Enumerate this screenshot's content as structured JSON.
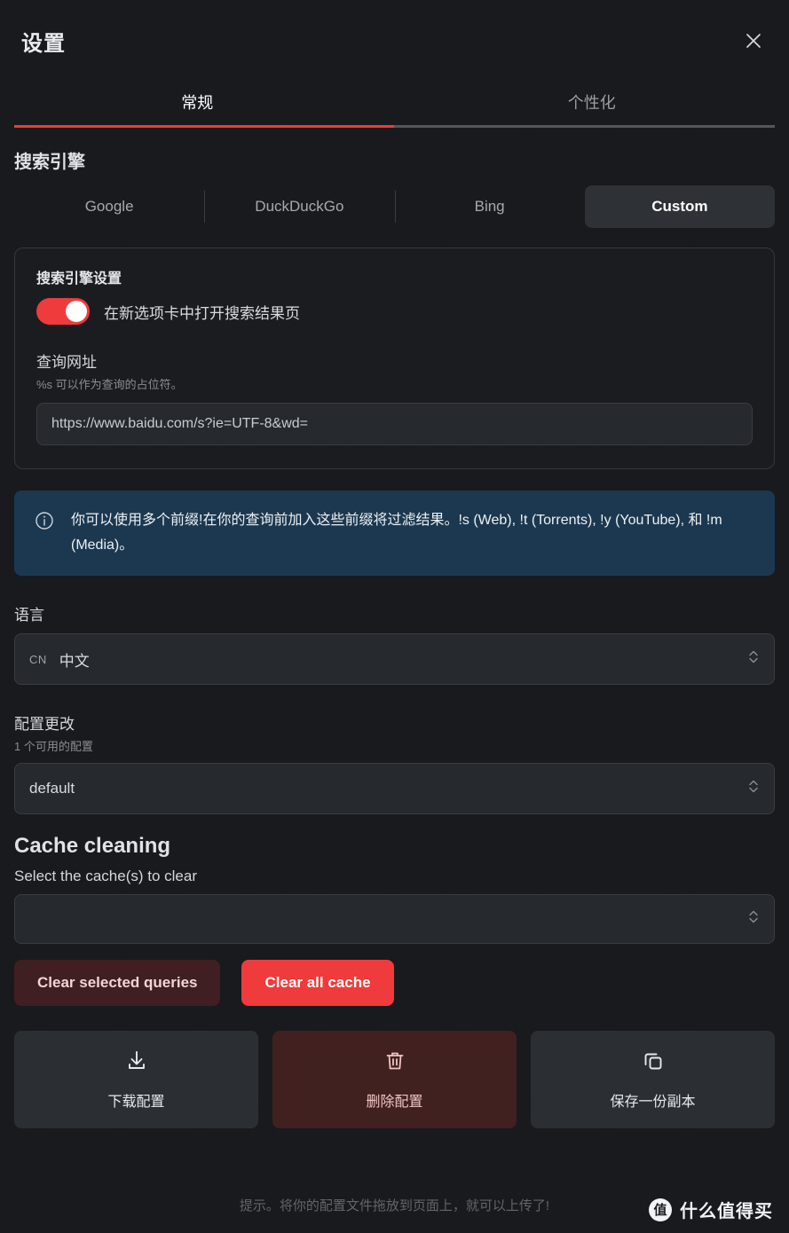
{
  "window": {
    "title": "设置",
    "close_icon": "close-icon"
  },
  "tabs": [
    {
      "label": "常规",
      "active": true
    },
    {
      "label": "个性化",
      "active": false
    }
  ],
  "search_engine": {
    "section_title": "搜索引擎",
    "options": [
      {
        "label": "Google",
        "active": false
      },
      {
        "label": "DuckDuckGo",
        "active": false
      },
      {
        "label": "Bing",
        "active": false
      },
      {
        "label": "Custom",
        "active": true
      }
    ],
    "card": {
      "title": "搜索引擎设置",
      "toggle": {
        "label": "在新选项卡中打开搜索结果页",
        "state": "on",
        "color": "#ef3b3b"
      },
      "query_url": {
        "label": "查询网址",
        "hint": "%s 可以作为查询的占位符。",
        "value": "https://www.baidu.com/s?ie=UTF-8&wd=",
        "placeholder": "https://www.baidu.com/s?ie=UTF-8&wd="
      }
    }
  },
  "info_banner": {
    "icon": "info-circle-icon",
    "text": "你可以使用多个前缀!在你的查询前加入这些前缀将过滤结果。!s (Web), !t (Torrents), !y (YouTube), 和 !m (Media)。",
    "background": "#1c3850"
  },
  "language": {
    "label": "语言",
    "flag": "CN",
    "value": "中文"
  },
  "config": {
    "label": "配置更改",
    "sub": "1 个可用的配置",
    "value": "default"
  },
  "cache": {
    "section_title": "Cache cleaning",
    "select_label": "Select the cache(s) to clear",
    "select_value": "",
    "clear_selected_label": "Clear selected queries",
    "clear_all_label": "Clear all cache",
    "clear_all_color": "#ef3b3b"
  },
  "actions": [
    {
      "label": "下载配置",
      "icon": "download-icon",
      "variant": "normal"
    },
    {
      "label": "删除配置",
      "icon": "trash-icon",
      "variant": "danger"
    },
    {
      "label": "保存一份副本",
      "icon": "copy-icon",
      "variant": "normal"
    }
  ],
  "footer": {
    "tip": "提示。将你的配置文件拖放到页面上，就可以上传了!",
    "watermark_badge": "值",
    "watermark_text": "什么值得买"
  }
}
